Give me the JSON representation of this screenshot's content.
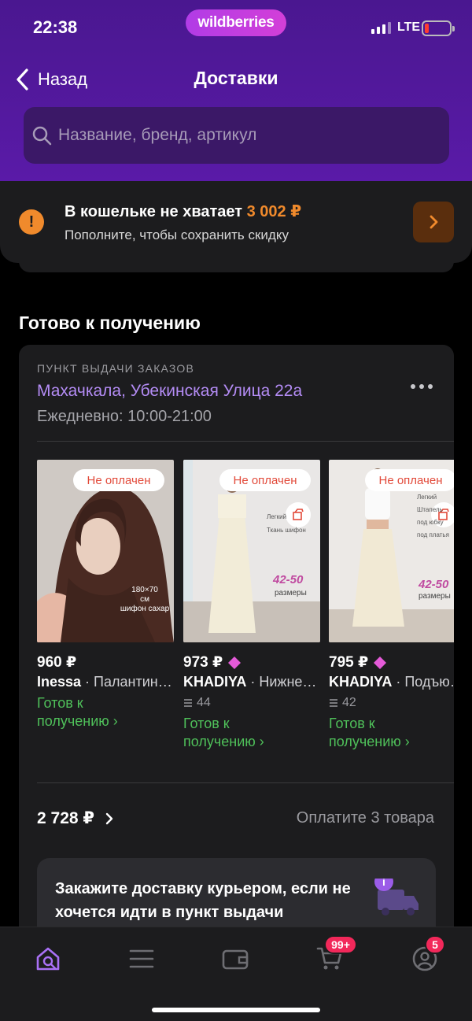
{
  "status_bar": {
    "time": "22:38",
    "network": "LTE"
  },
  "brand": "wildberries",
  "header": {
    "back_label": "Назад",
    "title": "Доставки"
  },
  "search": {
    "placeholder": "Название, бренд, артикул"
  },
  "wallet_banner": {
    "title": "В кошельке не хватает",
    "amount": "3 002 ₽",
    "subtitle": "Пополните, чтобы сохранить скидку"
  },
  "section": {
    "title": "Готово к получению"
  },
  "pickup": {
    "label": "ПУНКТ ВЫДАЧИ ЗАКАЗОВ",
    "address": "Махачкала, Убекинская Улица 22а",
    "hours": "Ежедневно: 10:00-21:00"
  },
  "products": [
    {
      "badge": "Не оплачен",
      "price": "960 ₽",
      "brand": "Inessa",
      "name": " · Палантин шифон",
      "status_line1": "Готов к",
      "status_line2": "получению ›",
      "img_text1": "180×70",
      "img_text2": "см",
      "img_text3": "шифон сахар"
    },
    {
      "badge": "Не оплачен",
      "price": "973 ₽",
      "brand": "KHADIYA",
      "name": " · Нижнее платье",
      "reviews": "44",
      "status_line1": "Готов к",
      "status_line2": "получению ›",
      "img_size": "42-50",
      "img_sizes": "размеры",
      "img_lines": [
        "Легкий",
        "Ткань шифон"
      ]
    },
    {
      "badge": "Не оплачен",
      "price": "795 ₽",
      "brand": "KHADIYA",
      "name": " · Подъюбник",
      "reviews": "42",
      "status_line1": "Готов к",
      "status_line2": "получению ›",
      "img_size": "42-50",
      "img_sizes": "размеры",
      "img_lines": [
        "Легкий",
        "Штапель",
        "под юбку",
        "под платья"
      ]
    }
  ],
  "summary": {
    "total": "2 728 ₽",
    "pay_label": "Оплатите 3 товара"
  },
  "courier": {
    "text": "Закажите доставку курьером, если не хочется идти в пункт выдачи"
  },
  "tabbar": {
    "cart_badge": "99+",
    "profile_badge": "5"
  },
  "colors": {
    "accent": "#b48cf5",
    "header": "#4a1790",
    "warning": "#f08a2c",
    "success": "#4fc05a",
    "badge": "#f2285a"
  }
}
